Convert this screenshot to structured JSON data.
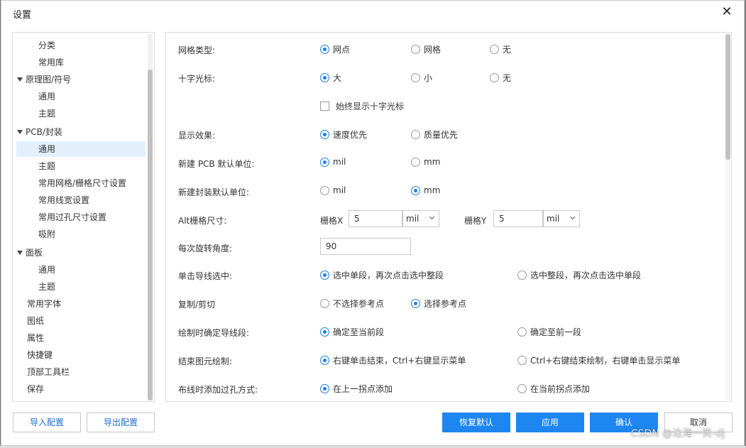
{
  "dialog": {
    "title": "设置",
    "close_label": "✕"
  },
  "sidebar": {
    "items": [
      {
        "label": "分类"
      },
      {
        "label": "常用库"
      },
      {
        "label": "原理图/符号"
      },
      {
        "label": "通用"
      },
      {
        "label": "主题"
      },
      {
        "label": "PCB/封装"
      },
      {
        "label": "通用"
      },
      {
        "label": "主题"
      },
      {
        "label": "常用网格/栅格尺寸设置"
      },
      {
        "label": "常用线宽设置"
      },
      {
        "label": "常用过孔尺寸设置"
      },
      {
        "label": "吸附"
      },
      {
        "label": "面板"
      },
      {
        "label": "通用"
      },
      {
        "label": "主题"
      },
      {
        "label": "常用字体"
      },
      {
        "label": "图纸"
      },
      {
        "label": "属性"
      },
      {
        "label": "快捷键"
      },
      {
        "label": "顶部工具栏"
      },
      {
        "label": "保存"
      }
    ]
  },
  "settings": {
    "grid_type": {
      "label": "网格类型:",
      "options": [
        "网点",
        "网格",
        "无"
      ],
      "selected": 0
    },
    "crosshair": {
      "label": "十字光标:",
      "options": [
        "大",
        "小",
        "无"
      ],
      "selected": 0
    },
    "always_show_crosshair": {
      "label": "始终显示十字光标",
      "checked": false
    },
    "display_effect": {
      "label": "显示效果:",
      "options": [
        "速度优先",
        "质量优先"
      ],
      "selected": 0
    },
    "pcb_unit": {
      "label": "新建 PCB 默认单位:",
      "options": [
        "mil",
        "mm"
      ],
      "selected": 0
    },
    "footprint_unit": {
      "label": "新建封装默认单位:",
      "options": [
        "mil",
        "mm"
      ],
      "selected": 1
    },
    "alt_grid": {
      "label": "Alt栅格尺寸:",
      "x_label": "栅格X",
      "x_value": "5",
      "x_unit": "mil",
      "y_label": "栅格Y",
      "y_value": "5",
      "y_unit": "mil"
    },
    "rotation": {
      "label": "每次旋转角度:",
      "value": "90"
    },
    "wire_click": {
      "label": "单击导线选中:",
      "options": [
        "选中单段，再次点击选中整段",
        "选中整段，再次点击选中单段"
      ],
      "selected": 0
    },
    "copy_cut": {
      "label": "复制/剪切",
      "options": [
        "不选择参考点",
        "选择参考点"
      ],
      "selected": 1
    },
    "draw_confirm": {
      "label": "绘制时确定导线段:",
      "options": [
        "确定至当前段",
        "确定至前一段"
      ],
      "selected": 0
    },
    "end_draw": {
      "label": "结束图元绘制:",
      "options": [
        "右键单击结束，Ctrl+右键显示菜单",
        "Ctrl+右键结束绘制，右键单击显示菜单"
      ],
      "selected": 0
    },
    "via_method": {
      "label": "布线时添加过孔方式:",
      "options": [
        "在上一拐点添加",
        "在当前拐点添加"
      ],
      "selected": 0
    }
  },
  "footer": {
    "import_label": "导入配置",
    "export_label": "导出配置",
    "restore_label": "恢复默认",
    "apply_label": "应用",
    "confirm_label": "确认",
    "cancel_label": "取消"
  },
  "watermark": "CSDN @沧海一笑-dj"
}
